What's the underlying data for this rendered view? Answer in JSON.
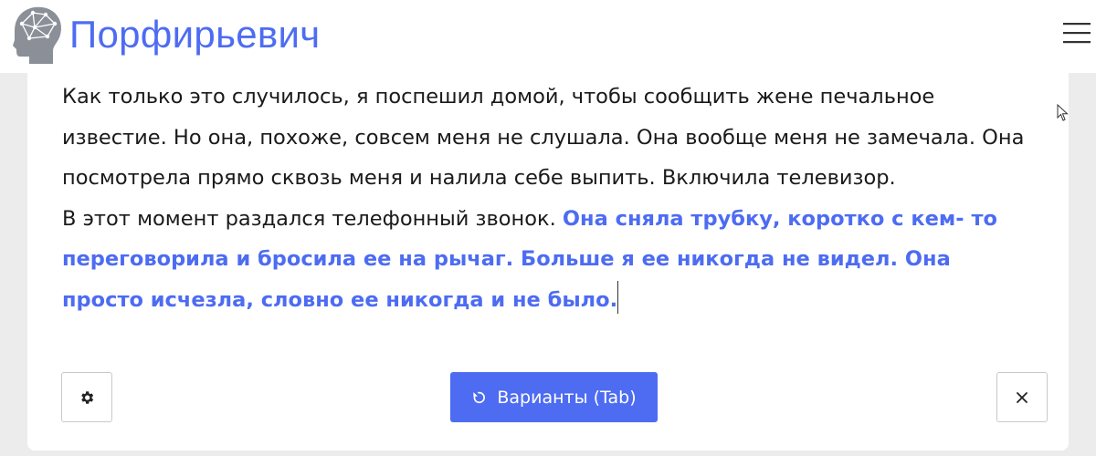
{
  "header": {
    "brand": "Порфирьевич",
    "logo_icon": "brain-head-logo",
    "menu_icon": "hamburger-menu-icon"
  },
  "editor": {
    "user_paragraph_1": "Как только это случилось, я поспешил домой, чтобы сообщить жене печальное известие. Но она, похоже, совсем меня не слушала. Она вообще меня не замечала. Она посмотрела прямо сквозь меня и налила себе выпить. Включила телевизор.",
    "user_paragraph_2": "В этот момент раздался телефонный звонок.",
    "generated_text": "Она сняла трубку, коротко с кем- то переговорила и бросила ее на рычаг. Больше я ее никогда не видел. Она просто исчезла, словно ее никогда и не было."
  },
  "toolbar": {
    "settings_icon": "gear-icon",
    "variants_icon": "refresh-icon",
    "variants_label": "Варианты (Tab)",
    "close_icon": "close-icon"
  },
  "colors": {
    "accent": "#4d6cf2",
    "text": "#1a1a1a",
    "background": "#ececec"
  }
}
